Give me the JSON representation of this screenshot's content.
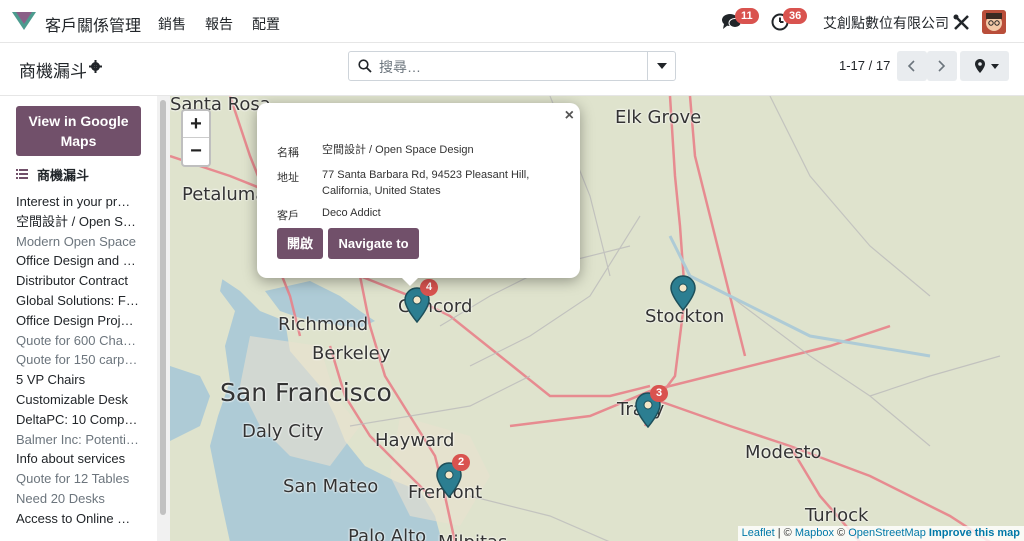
{
  "nav": {
    "app_name": "客戶關係管理",
    "menu": [
      "銷售",
      "報告",
      "配置"
    ],
    "messages_count": "11",
    "activities_count": "36",
    "company": "艾創點數位有限公司"
  },
  "control": {
    "breadcrumb": "商機漏斗",
    "search_placeholder": "搜尋…",
    "pager": "1-17 / 17"
  },
  "sidebar": {
    "google_maps_button": "View in Google Maps",
    "list_title": "商機漏斗",
    "items": [
      {
        "label": "Interest in your pr…",
        "muted": false
      },
      {
        "label": "空間設計 / Open S…",
        "muted": false
      },
      {
        "label": "Modern Open Space",
        "muted": true
      },
      {
        "label": "Office Design and …",
        "muted": false
      },
      {
        "label": "Distributor Contract",
        "muted": false
      },
      {
        "label": "Global Solutions: F…",
        "muted": false
      },
      {
        "label": "Office Design Proj…",
        "muted": false
      },
      {
        "label": "Quote for 600 Cha…",
        "muted": true
      },
      {
        "label": "Quote for 150 carp…",
        "muted": true
      },
      {
        "label": "5 VP Chairs",
        "muted": false
      },
      {
        "label": "Customizable Desk",
        "muted": false
      },
      {
        "label": "DeltaPC: 10 Comp…",
        "muted": false
      },
      {
        "label": "Balmer Inc: Potenti…",
        "muted": true
      },
      {
        "label": "Info about services",
        "muted": false
      },
      {
        "label": "Quote for 12 Tables",
        "muted": true
      },
      {
        "label": "Need 20 Desks",
        "muted": true
      },
      {
        "label": "Access to Online …",
        "muted": false
      }
    ]
  },
  "map": {
    "zoom_in": "+",
    "zoom_out": "−",
    "places": [
      {
        "name": "Santa Rosa"
      },
      {
        "name": "Petaluma"
      },
      {
        "name": "Elk Grove"
      },
      {
        "name": "Richmond"
      },
      {
        "name": "Concord"
      },
      {
        "name": "Berkeley"
      },
      {
        "name": "San Francisco"
      },
      {
        "name": "Daly City"
      },
      {
        "name": "Hayward"
      },
      {
        "name": "San Mateo"
      },
      {
        "name": "Fremont"
      },
      {
        "name": "Stockton"
      },
      {
        "name": "Tracy"
      },
      {
        "name": "Modesto"
      },
      {
        "name": "Turlock"
      },
      {
        "name": "Palo Alto"
      },
      {
        "name": "Milpitas"
      }
    ],
    "markers": [
      {
        "count": "4"
      },
      {
        "count": ""
      },
      {
        "count": "3"
      },
      {
        "count": "2"
      }
    ],
    "popup": {
      "name_label": "名稱",
      "name_value": "空間設計 / Open Space Design",
      "address_label": "地址",
      "address_value": "77 Santa Barbara Rd, 94523 Pleasant Hill, California, United States",
      "customer_label": "客戶",
      "customer_value": "Deco Addict",
      "open_button": "開啟",
      "navigate_button": "Navigate to",
      "close": "×"
    },
    "attribution": {
      "leaflet": "Leaflet",
      "sep1": " | © ",
      "mapbox": "Mapbox",
      "sep2": " © ",
      "osm": "OpenStreetMap",
      "improve": "Improve this map"
    }
  },
  "colors": {
    "brand": "#71506a",
    "badge": "#d9534f",
    "marker": "#2c7e91"
  }
}
